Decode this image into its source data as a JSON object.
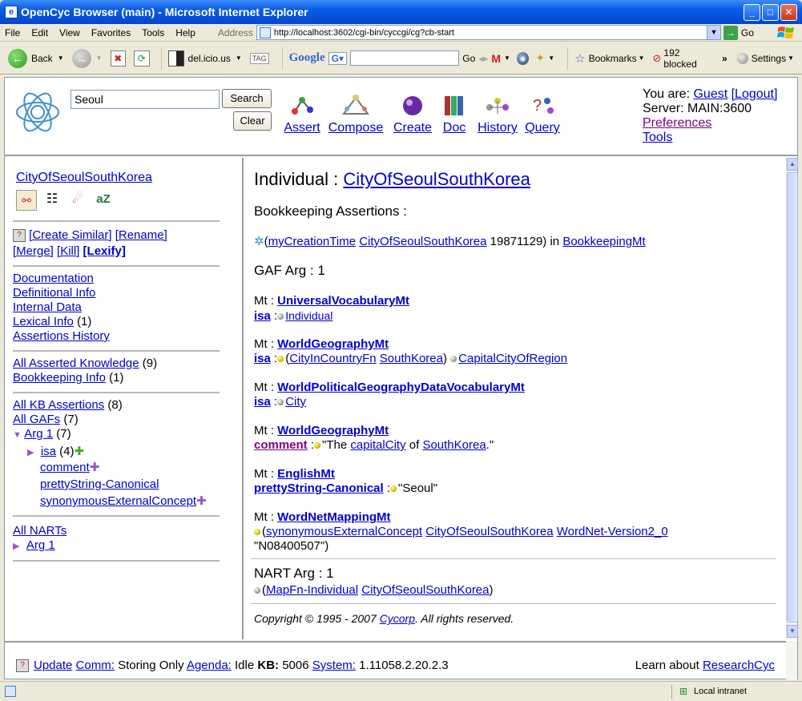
{
  "window": {
    "title": "OpenCyc Browser (main) - Microsoft Internet Explorer"
  },
  "menu": [
    "File",
    "Edit",
    "View",
    "Favorites",
    "Tools",
    "Help"
  ],
  "address": {
    "label": "Address",
    "url": "http://localhost:3602/cgi-bin/cyccgi/cg?cb-start",
    "go": "Go"
  },
  "toolbar": {
    "back": "Back",
    "delicious": "del.icio.us",
    "tag": "TAG",
    "google": "Google",
    "go": "Go",
    "bookmarks": "Bookmarks",
    "blocked": "192 blocked",
    "settings": "Settings"
  },
  "header": {
    "search_value": "Seoul",
    "search_btn": "Search",
    "clear_btn": "Clear",
    "icons": [
      "Assert",
      "Compose",
      "Create",
      "Doc",
      "History",
      "Query"
    ],
    "you_are": "You are:",
    "guest": "Guest",
    "logout": "[Logout]",
    "server": "Server: MAIN:3600",
    "preferences": "Preferences",
    "tools": "Tools"
  },
  "sidebar": {
    "term": "CityOfSeoulSouthKorea",
    "create_similar": "[Create Similar]",
    "rename": "[Rename]",
    "merge": "[Merge]",
    "kill": "[Kill]",
    "lexify": "[Lexify]",
    "documentation": "Documentation",
    "definitional": "Definitional Info",
    "internal": "Internal Data",
    "lexical": "Lexical Info",
    "lexical_count": "(1)",
    "history": "Assertions History",
    "all_asserted": "All Asserted Knowledge",
    "all_asserted_count": "(9)",
    "bookkeeping": "Bookkeeping Info",
    "bookkeeping_count": "(1)",
    "all_kb": "All KB Assertions",
    "all_kb_count": "(8)",
    "all_gafs": "All GAFs",
    "all_gafs_count": "(7)",
    "arg1": "Arg 1",
    "arg1_count": "(7)",
    "isa": "isa",
    "isa_count": "(4)",
    "comment": "comment",
    "pretty": "prettyString-Canonical",
    "synonymous": "synonymousExternalConcept",
    "all_narts": "All NARTs",
    "narts_arg1": "Arg 1"
  },
  "main": {
    "individual": "Individual :",
    "term": "CityOfSeoulSouthKorea",
    "bookkeeping": "Bookkeeping Assertions :",
    "bk_pred": "myCreationTime",
    "bk_term": "CityOfSeoulSouthKorea",
    "bk_date": "19871129)",
    "bk_in": "in",
    "bk_mt": "BookkeepingMt",
    "gaf": "GAF Arg : 1",
    "mt_label": "Mt :",
    "mt1": "UniversalVocabularyMt",
    "isa1": "isa",
    "isa1_val": "Individual",
    "mt2": "WorldGeographyMt",
    "isa2": "isa",
    "isa2_fn": "CityInCountryFn",
    "isa2_arg": "SouthKorea",
    "isa2_val": "CapitalCityOfRegion",
    "mt3": "WorldPoliticalGeographyDataVocabularyMt",
    "isa3": "isa",
    "isa3_val": "City",
    "mt4": "WorldGeographyMt",
    "comment": "comment",
    "comment_pre": "\"The",
    "comment_link1": "capitalCity",
    "comment_of": "of",
    "comment_link2": "SouthKorea",
    "comment_post": ".\"",
    "mt5": "EnglishMt",
    "pretty": "prettyString-Canonical",
    "pretty_val": "\"Seoul\"",
    "mt6": "WordNetMappingMt",
    "syn_pred": "synonymousExternalConcept",
    "syn_term": "CityOfSeoulSouthKorea",
    "syn_wn": "WordNet-Version2_0",
    "syn_val": "\"N08400507\")",
    "nart": "NART Arg : 1",
    "nart_fn": "MapFn-Individual",
    "nart_term": "CityOfSeoulSouthKorea",
    "copyright": "Copyright © 1995 - 2007",
    "cycorp": "Cycorp",
    "rights": ". All rights reserved."
  },
  "footer": {
    "update": "Update",
    "comm": "Comm:",
    "comm_val": "Storing Only",
    "agenda": "Agenda:",
    "agenda_val": "Idle",
    "kb": "KB:",
    "kb_val": "5006",
    "system": "System:",
    "system_val": "1.11058.2.20.2.3",
    "learn": "Learn about",
    "research": "ResearchCyc"
  },
  "status": {
    "zone": "Local intranet"
  }
}
